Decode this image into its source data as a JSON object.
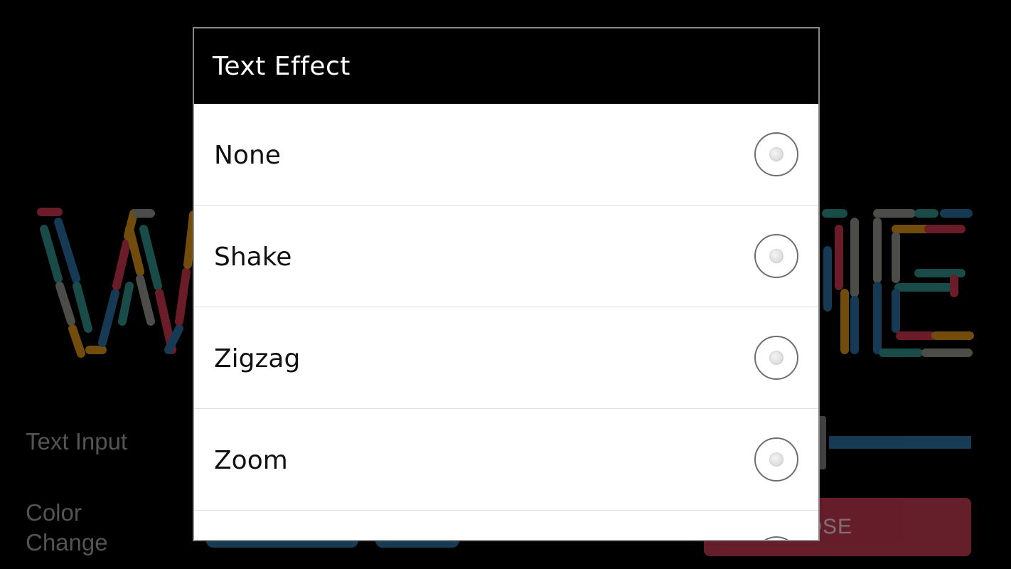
{
  "background": {
    "text_input_label": "Text Input",
    "color_change_label": "Color Change",
    "close_button_label": "LOSE"
  },
  "dialog": {
    "title": "Text Effect",
    "options": [
      {
        "label": "None"
      },
      {
        "label": "Shake"
      },
      {
        "label": "Zigzag"
      },
      {
        "label": "Zoom"
      },
      {
        "label": ""
      }
    ]
  },
  "colors": {
    "dialog_header": "#000000",
    "dialog_body": "#ffffff",
    "close_button": "#b8384c",
    "slider": "#2a6a9a",
    "dash_palette": [
      "#c2334a",
      "#2f8a86",
      "#d08a19",
      "#8a8a86",
      "#2a6a9a"
    ]
  }
}
